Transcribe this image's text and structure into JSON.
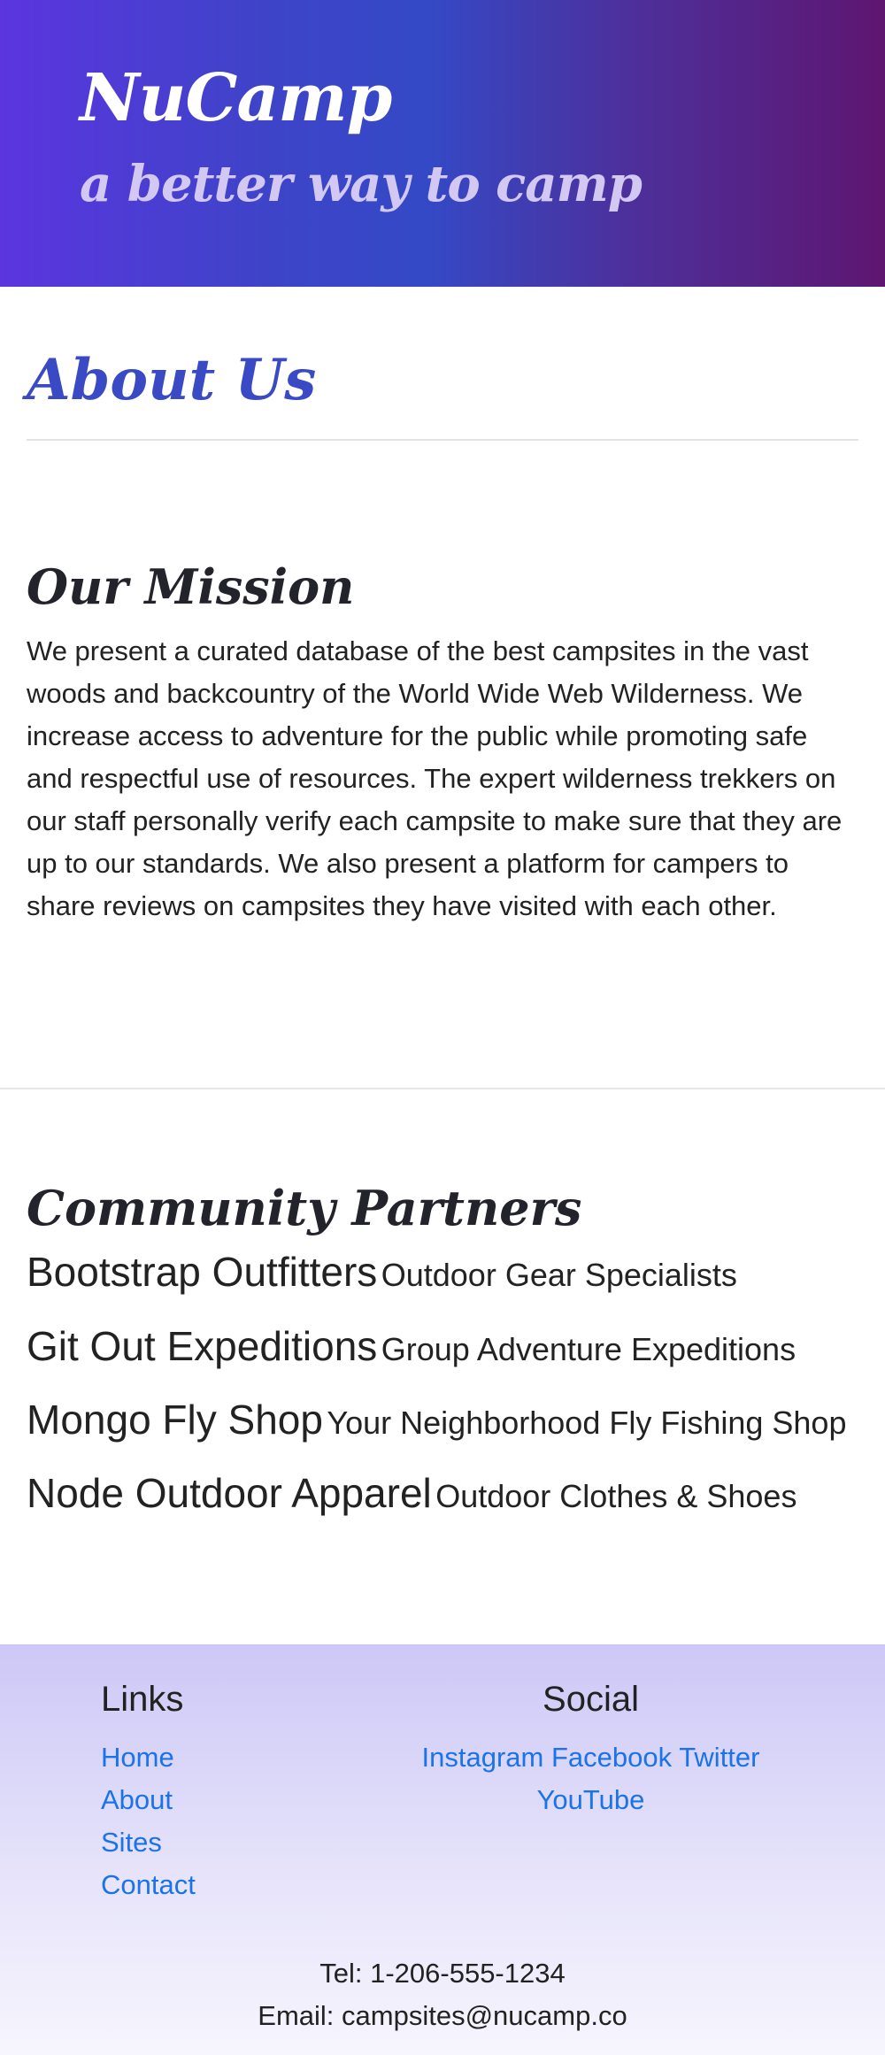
{
  "header": {
    "brand": "NuCamp",
    "tagline": "a better way to camp"
  },
  "about": {
    "title": "About Us"
  },
  "mission": {
    "title": "Our Mission",
    "text": "We present a curated database of the best campsites in the vast woods and backcountry of the World Wide Web Wilderness. We increase access to adventure for the public while promoting safe and respectful use of resources. The expert wilderness trekkers on our staff personally verify each campsite to make sure that they are up to our standards. We also present a platform for campers to share reviews on campsites they have visited with each other."
  },
  "partners": {
    "title": "Community Partners",
    "items": [
      {
        "name": "Bootstrap Outfitters",
        "desc": "Outdoor Gear Specialists"
      },
      {
        "name": "Git Out Expeditions",
        "desc": "Group Adventure Expeditions"
      },
      {
        "name": "Mongo Fly Shop",
        "desc": "Your Neighborhood Fly Fishing Shop"
      },
      {
        "name": "Node Outdoor Apparel",
        "desc": "Outdoor Clothes & Shoes"
      }
    ]
  },
  "footer": {
    "links_heading": "Links",
    "links": [
      "Home",
      "About",
      "Sites",
      "Contact"
    ],
    "social_heading": "Social",
    "social": [
      "Instagram",
      "Facebook",
      "Twitter",
      "YouTube"
    ],
    "tel": "Tel: 1-206-555-1234",
    "email": "Email: campsites@nucamp.co"
  },
  "colors": {
    "accent_heading": "#3a4ac4",
    "link": "#1a73e8",
    "header_gradient_start": "#5b35df",
    "header_gradient_end": "#5e1670"
  }
}
